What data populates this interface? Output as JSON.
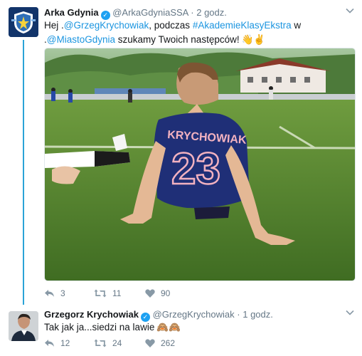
{
  "tweets": [
    {
      "author": {
        "name": "Arka Gdynia",
        "handle": "@ArkaGdyniaSSA"
      },
      "time": "2 godz.",
      "text": {
        "p1": "Hej .",
        "mention1": "@GrzegKrychowiak",
        "p2": ", podczas ",
        "hashtag": "#AkademieKlasyEkstra",
        "p3": " w .",
        "mention2": "@MiastoGdynia",
        "p4": " szukamy Twoich następców!",
        "emoji": "👋✌"
      },
      "media": {
        "shirt_name": "KRYCHOWIAK",
        "shirt_number": "23"
      },
      "stats": {
        "replies": "3",
        "retweets": "11",
        "likes": "90"
      }
    },
    {
      "author": {
        "name": "Grzegorz Krychowiak",
        "handle": "@GrzegKrychowiak"
      },
      "time": "1 godz.",
      "text": {
        "body": "Tak jak ja...siedzi na lawie",
        "emoji": "🙈🙈"
      },
      "stats": {
        "replies": "12",
        "retweets": "24",
        "likes": "262"
      }
    }
  ],
  "colors": {
    "link": "#1b95e0",
    "thread": "#2aa3d7",
    "verified": "#1da1f2",
    "muted": "#657786"
  }
}
